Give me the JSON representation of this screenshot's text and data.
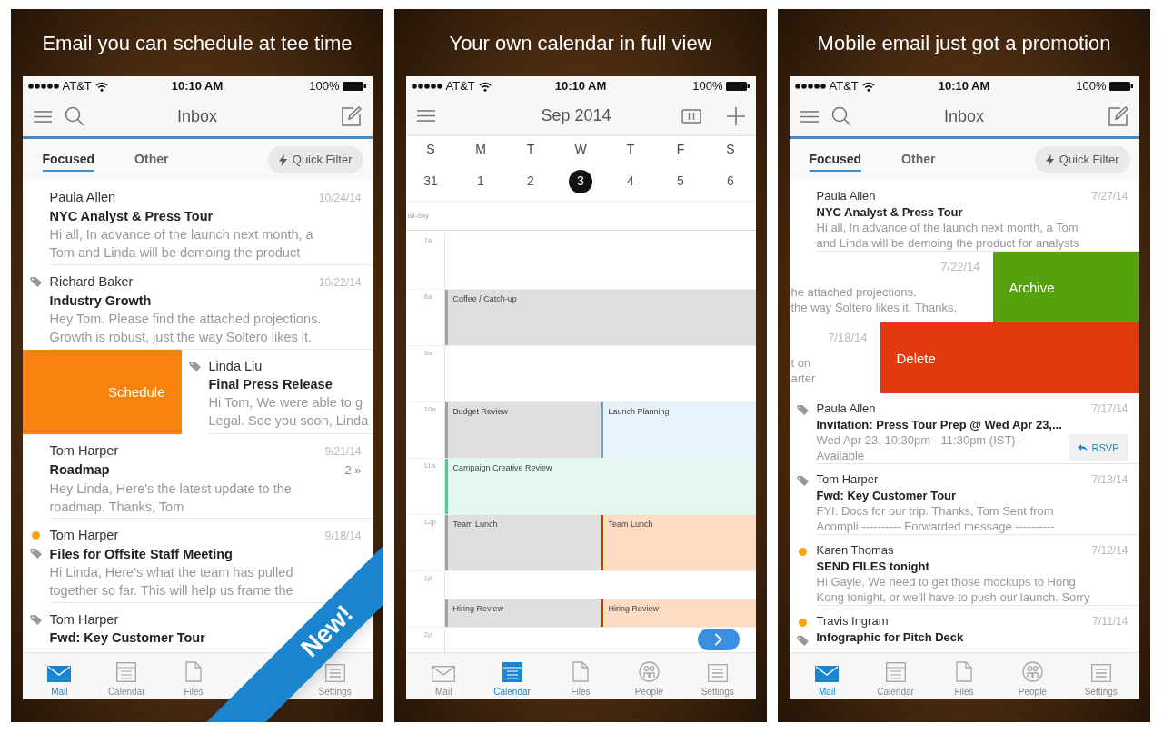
{
  "panels": [
    {
      "kind": "mail",
      "caption": "Email you can schedule at tee time",
      "status": {
        "carrier": "AT&T",
        "time": "10:10 AM",
        "battery": "100%"
      },
      "header": {
        "title": "Inbox"
      },
      "tabs": [
        {
          "label": "Focused",
          "selected": true
        },
        {
          "label": "Other",
          "selected": false
        }
      ],
      "quick_filter": "Quick Filter",
      "messages": [
        {
          "sender": "Paula Allen",
          "subject": "NYC Analyst & Press Tour",
          "preview": [
            "Hi all, In advance of the launch next month, a",
            "Tom and Linda will be demoing the product"
          ],
          "date": "10/24/14",
          "flagged": false,
          "tagged": false
        },
        {
          "sender": "Richard Baker",
          "subject": "Industry Growth",
          "preview": [
            "Hey Tom. Please find the attached projections.",
            "Growth is robust, just the way Soltero likes it."
          ],
          "date": "10/22/14",
          "flagged": false,
          "tagged": true
        },
        {
          "sender": "Linda Liu",
          "subject": "Final Press Release",
          "preview": [
            "Hi Tom, We were able to g",
            "Legal. See you soon, Linda"
          ],
          "flagged": false,
          "tagged": true,
          "swipe": {
            "kind": "schedule",
            "label": "Schedule"
          }
        },
        {
          "sender": "Tom Harper",
          "subject": "Roadmap",
          "preview": [
            "Hey Linda, Here's the latest update to the",
            "roadmap. Thanks, Tom"
          ],
          "date": "9/21/14",
          "count": "2 »",
          "flagged": false,
          "tagged": false
        },
        {
          "sender": "Tom Harper",
          "subject": "Files for Offsite Staff Meeting",
          "preview": [
            "Hi Linda, Here's what the team has pulled",
            "together so far. This will help us frame the"
          ],
          "date": "9/18/14",
          "flagged": true,
          "tagged": true
        },
        {
          "sender": "Tom Harper",
          "subject": "Fwd: Key Customer Tour",
          "flagged": false,
          "tagged": true
        }
      ],
      "tab_bar": [
        {
          "kind": "item",
          "label": "Mail",
          "selected": true
        },
        {
          "kind": "item",
          "label": "Calendar",
          "selected": false
        },
        {
          "kind": "item",
          "label": "Files",
          "selected": false
        },
        {
          "kind": "covered"
        },
        {
          "kind": "item",
          "label": "Settings",
          "selected": false
        }
      ],
      "ribbon": "New!"
    },
    {
      "kind": "calendar",
      "caption": "Your own calendar in full view",
      "status": {
        "carrier": "AT&T",
        "time": "10:10 AM",
        "battery": "100%"
      },
      "header": {
        "title": "Sep 2014"
      },
      "days": [
        {
          "weekday": "S",
          "date": "31",
          "selected": false
        },
        {
          "weekday": "M",
          "date": "1",
          "selected": false
        },
        {
          "weekday": "T",
          "date": "2",
          "selected": false
        },
        {
          "weekday": "W",
          "date": "3",
          "selected": true
        },
        {
          "weekday": "T",
          "date": "4",
          "selected": false
        },
        {
          "weekday": "F",
          "date": "5",
          "selected": false
        },
        {
          "weekday": "S",
          "date": "6",
          "selected": false
        }
      ],
      "all_day": "all-day",
      "hours": [
        {
          "label": "7a"
        },
        {
          "label": "8a",
          "events": [
            {
              "title": "Coffee / Catch-up",
              "color": "#dfdfdf",
              "half_hour": false
            }
          ]
        },
        {
          "label": "9a"
        },
        {
          "label": "10a",
          "events": [
            {
              "title": "Budget Review",
              "color": "#dfdfdf",
              "half_hour": false
            },
            {
              "title": "Launch Planning",
              "color": "#e6f3fa",
              "half_hour": false
            }
          ]
        },
        {
          "label": "11a",
          "events": [
            {
              "title": "Campaign Creative Review",
              "color": "#e3f9ef",
              "half_hour": false
            }
          ]
        },
        {
          "label": "12p",
          "events": [
            {
              "title": "Team Lunch",
              "color": "#dfdfdf",
              "half_hour": false
            },
            {
              "title": "Team Lunch",
              "color": "#fcdcc2",
              "half_hour": false
            }
          ]
        },
        {
          "label": "1p",
          "events": [
            {
              "title": "Hiring Review",
              "color": "#dfdfdf",
              "half_hour": true
            },
            {
              "title": "Hiring Review",
              "color": "#fcdcc2",
              "half_hour": true
            }
          ]
        },
        {
          "label": "2p"
        }
      ],
      "tab_bar": [
        {
          "kind": "item",
          "label": "Mail",
          "selected": false
        },
        {
          "kind": "item",
          "label": "Calendar",
          "selected": true
        },
        {
          "kind": "item",
          "label": "Files",
          "selected": false
        },
        {
          "kind": "item",
          "label": "People",
          "selected": false
        },
        {
          "kind": "item",
          "label": "Settings",
          "selected": false
        }
      ]
    },
    {
      "kind": "mail",
      "caption": "Mobile email just got a promotion",
      "status": {
        "carrier": "AT&T",
        "time": "10:10 AM",
        "battery": "100%"
      },
      "header": {
        "title": "Inbox"
      },
      "tabs": [
        {
          "label": "Focused",
          "selected": true
        },
        {
          "label": "Other",
          "selected": false
        }
      ],
      "quick_filter": "Quick Filter",
      "messages": [
        {
          "sender": "Paula Allen",
          "subject": "NYC Analyst & Press Tour",
          "preview": [
            "Hi all, In advance of the launch next month, a Tom",
            "and Linda will be demoing the product for analysts"
          ],
          "date": "7/27/14",
          "flagged": false,
          "tagged": false
        },
        {
          "preview": [
            "he attached projections.",
            "the way Soltero likes it. Thanks,"
          ],
          "date": "7/22/14",
          "swipe": {
            "kind": "archive",
            "label": "Archive"
          }
        },
        {
          "preview": [
            "t on",
            "arter"
          ],
          "date": "7/18/14",
          "swipe": {
            "kind": "delete",
            "label": "Delete"
          }
        },
        {
          "sender": "Paula Allen",
          "subject": "Invitation: Press Tour Prep @ Wed Apr 23,...",
          "preview": [
            "Wed Apr 23, 10:30pm - 11:30pm (IST) -",
            "Available"
          ],
          "date": "7/17/14",
          "rsvp": "RSVP",
          "flagged": false,
          "tagged": true
        },
        {
          "sender": "Tom Harper",
          "subject": "Fwd: Key Customer Tour",
          "preview": [
            "FYI. Docs for our trip. Thanks, Tom Sent from",
            "Acompli ---------- Forwarded message ----------"
          ],
          "date": "7/13/14",
          "flagged": false,
          "tagged": true
        },
        {
          "sender": "Karen Thomas",
          "subject": "SEND FILES tonight",
          "preview": [
            "Hi Gayle, We need to get those mockups to Hong",
            "Kong tonight, or we'll have to push our launch. Sorry"
          ],
          "date": "7/12/14",
          "flagged": true,
          "tagged": false
        },
        {
          "sender": "Travis Ingram",
          "subject": "Infographic for Pitch Deck",
          "date": "7/11/14",
          "flagged": true,
          "tagged": true
        }
      ],
      "tab_bar": [
        {
          "kind": "item",
          "label": "Mail",
          "selected": true
        },
        {
          "kind": "item",
          "label": "Calendar",
          "selected": false
        },
        {
          "kind": "item",
          "label": "Files",
          "selected": false
        },
        {
          "kind": "item",
          "label": "People",
          "selected": false
        },
        {
          "kind": "item",
          "label": "Settings",
          "selected": false
        }
      ]
    }
  ]
}
